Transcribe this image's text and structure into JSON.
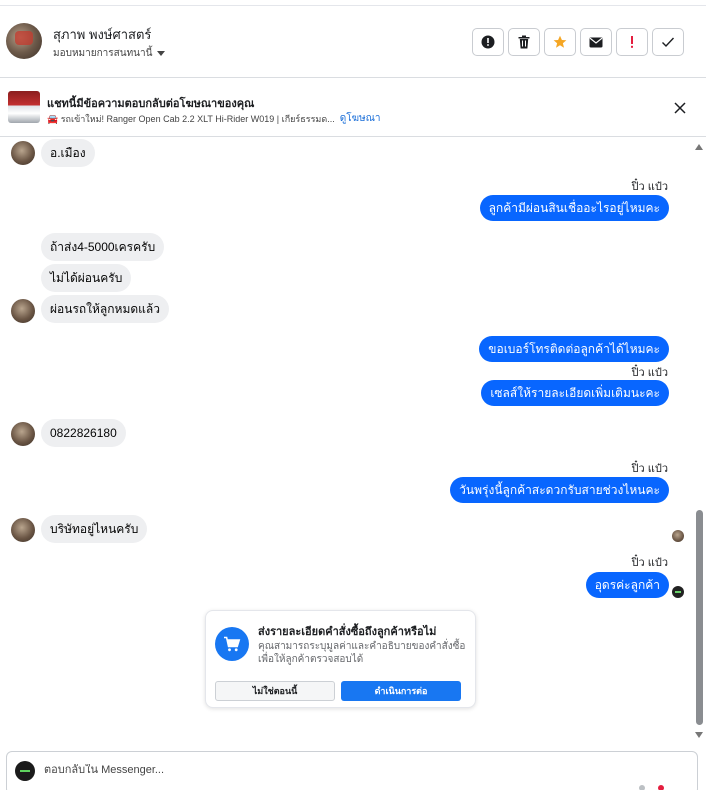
{
  "header": {
    "contact_name": "สุภาพ พงษ์ศาสตร์",
    "assign_label": "มอบหมายการสนทนานี้",
    "actions": [
      {
        "name": "info-icon",
        "label": "Info"
      },
      {
        "name": "trash-icon",
        "label": "Delete"
      },
      {
        "name": "star-icon",
        "label": "Star",
        "color": "#f5a623"
      },
      {
        "name": "envelope-icon",
        "label": "Mark unread"
      },
      {
        "name": "exclamation-icon",
        "label": "Spam",
        "color": "#e41e3f"
      },
      {
        "name": "checkmark-icon",
        "label": "Done"
      }
    ]
  },
  "ad": {
    "title": "แชทนี้มีข้อความตอบกลับต่อโฆษณาของคุณ",
    "description": "🚘 รถเข้าใหม่! Ranger Open Cab 2.2 XLT Hi-Rider W019 | เกียร์ธรรมด...",
    "view_ad_label": "ดูโฆษณา"
  },
  "messages": [
    {
      "dir": "in",
      "text": "อ.เมือง"
    },
    {
      "dir": "out",
      "sender": "ปิ๋ว แป๋ว",
      "text": "ลูกค้ามีผ่อนสินเชื่ออะไรอยู่ไหมคะ"
    },
    {
      "dir": "in",
      "text": "ถ้าส่ง4-5000เครครับ"
    },
    {
      "dir": "in",
      "text": "ไม่ได้ผ่อนครับ"
    },
    {
      "dir": "in",
      "text": "ผ่อนรถให้ลูกหมดแล้ว"
    },
    {
      "dir": "out",
      "text": "ขอเบอร์โทรติดต่อลูกค้าได้ไหมคะ"
    },
    {
      "dir": "out",
      "sender": "ปิ๋ว แป๋ว",
      "text": "เซลส์ให้รายละเอียดเพิ่มเติมนะคะ"
    },
    {
      "dir": "in",
      "text": "0822826180"
    },
    {
      "dir": "out",
      "sender": "ปิ๋ว แป๋ว",
      "text": "วันพรุ่งนี้ลูกค้าสะดวกรับสายช่วงไหนคะ"
    },
    {
      "dir": "in",
      "text": "บริษัทอยู่ไหนครับ"
    },
    {
      "dir": "out",
      "sender": "ปิ๋ว แป๋ว",
      "text": "อุดรค่ะลูกค้า"
    }
  ],
  "order_card": {
    "title": "ส่งรายละเอียดคำสั่งซื้อถึงลูกค้าหรือไม่",
    "description": "คุณสามารถระบุมูลค่าและคำอธิบายของคำสั่งซื้อเพื่อให้ลูกค้าตรวจสอบได้",
    "secondary_label": "ไม่ใช่ตอนนี้",
    "primary_label": "ดำเนินการต่อ",
    "icon": "cart-icon",
    "accent": "#1877f2"
  },
  "composer": {
    "placeholder": "ตอบกลับใน Messenger..."
  },
  "colors": {
    "outgoing_bubble": "#0866ff",
    "incoming_bubble": "#eeeff1"
  }
}
